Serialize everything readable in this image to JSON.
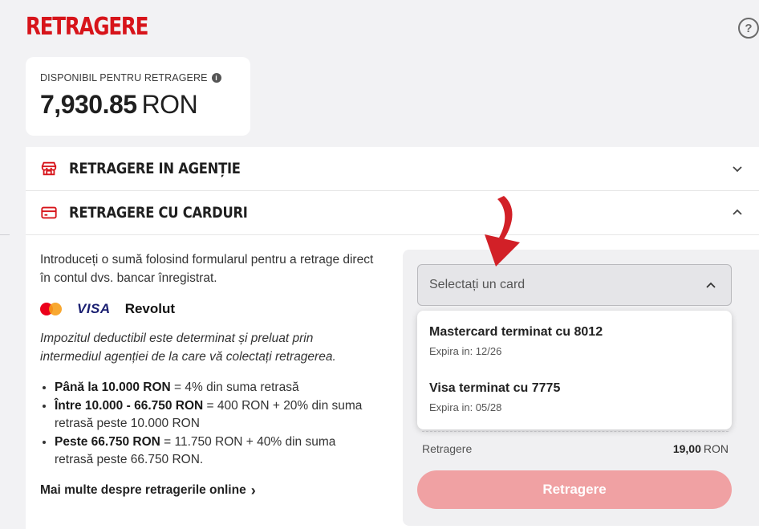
{
  "header": {
    "title": "RETRAGERE",
    "help_icon": "?"
  },
  "balance": {
    "label": "DISPONIBIL PENTRU RETRAGERE",
    "info_icon": "i",
    "amount": "7,930.85",
    "currency": "RON"
  },
  "sections": [
    {
      "title": "RETRAGERE IN AGENȚIE",
      "icon": "store-icon",
      "expanded": false
    },
    {
      "title": "RETRAGERE CU CARDURI",
      "icon": "card-icon",
      "expanded": true
    }
  ],
  "cards_section": {
    "intro": "Introduceți o sumă folosind formularul pentru a retrage direct în contul dvs. bancar înregistrat.",
    "logos": [
      "mastercard",
      "VISA",
      "Revolut"
    ],
    "tax_note": "Impozitul deductibil este determinat și preluat prin intermediul agenției de la care vă colectați retragerea.",
    "rules": [
      {
        "bold": "Până la 10.000 RON",
        "text": " = 4% din suma retrasă"
      },
      {
        "bold": "Între 10.000 - 66.750 RON",
        "text": " = 400 RON + 20% din suma retrasă peste 10.000 RON"
      },
      {
        "bold": "Peste 66.750 RON",
        "text": " = 11.750 RON + 40% din suma retrasă peste 66.750 RON."
      }
    ],
    "more_link": "Mai multe despre retragerile online",
    "more_link_chevron": "›"
  },
  "card_select": {
    "placeholder": "Selectați un card",
    "options": [
      {
        "name": "Mastercard terminat cu 8012",
        "expiry": "Expira in: 12/26"
      },
      {
        "name": "Visa terminat cu 7775",
        "expiry": "Expira in: 05/28"
      }
    ]
  },
  "fee": {
    "label": "Retragere",
    "value": "19,00",
    "currency": "RON"
  },
  "withdraw_button": {
    "label": "Retragere",
    "enabled": false
  },
  "colors": {
    "brand": "#d7141a",
    "button_disabled": "#f0a1a3",
    "annotation_arrow": "#d22027"
  }
}
